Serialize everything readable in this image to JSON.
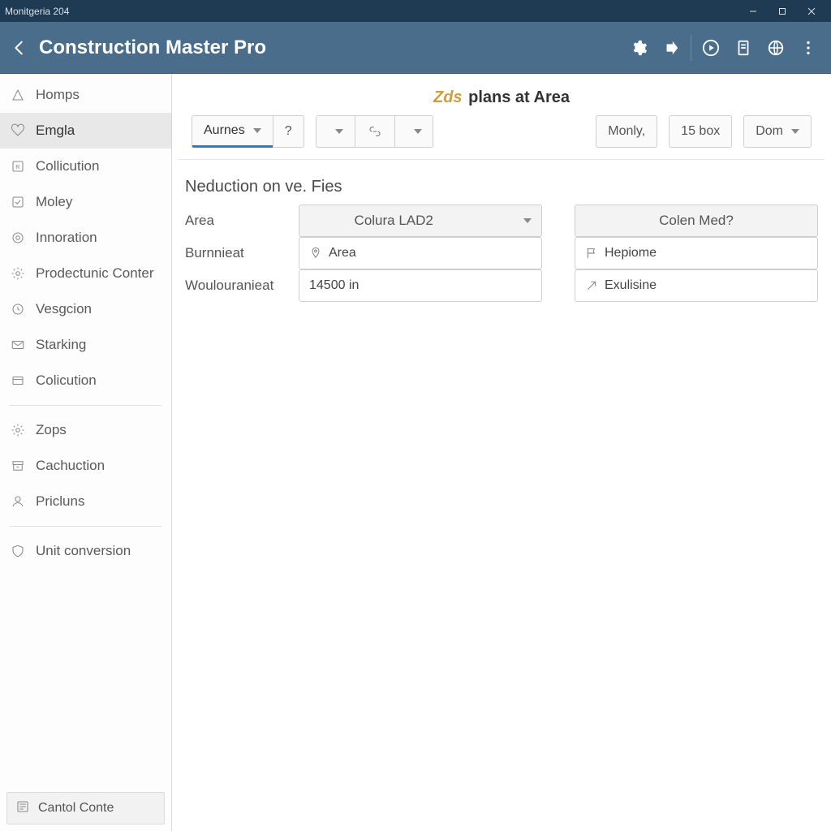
{
  "window": {
    "title": "Monitgeria 204"
  },
  "header": {
    "app_title": "Construction Master Pro"
  },
  "sidebar": {
    "groups": [
      [
        {
          "label": "Homps"
        },
        {
          "label": "Emgla",
          "active": true
        },
        {
          "label": "Collicution"
        },
        {
          "label": "Moley"
        },
        {
          "label": "Innoration"
        },
        {
          "label": "Prodectunic Conter"
        },
        {
          "label": "Vesgcion"
        },
        {
          "label": "Starking"
        },
        {
          "label": "Colicution"
        }
      ],
      [
        {
          "label": "Zops"
        },
        {
          "label": "Cachuction"
        },
        {
          "label": "Pricluns"
        }
      ],
      [
        {
          "label": "Unit conversion"
        }
      ]
    ],
    "footer_button": "Cantol Conte"
  },
  "page": {
    "title_accent": "Zds",
    "title_rest": "plans at Area",
    "toolbar": {
      "primary": "Aurnes",
      "help": "?",
      "mid_icon": "link",
      "right": {
        "a": "Monly,",
        "b": "15 box",
        "c": "Dom"
      }
    },
    "section_title": "Neduction on ve. Fies",
    "form": {
      "rows": [
        {
          "label": "Area",
          "head_a": "Colura LAD2",
          "head_b": "Colen Med?"
        },
        {
          "label": "Burnnieat",
          "val_a": "Area",
          "icon_a": "pin",
          "val_b": "Hepiome",
          "icon_b": "flag"
        },
        {
          "label": "Woulouranieat",
          "val_a": "14500 in",
          "val_b": "Exulisine",
          "icon_b": "arrow"
        }
      ]
    }
  }
}
